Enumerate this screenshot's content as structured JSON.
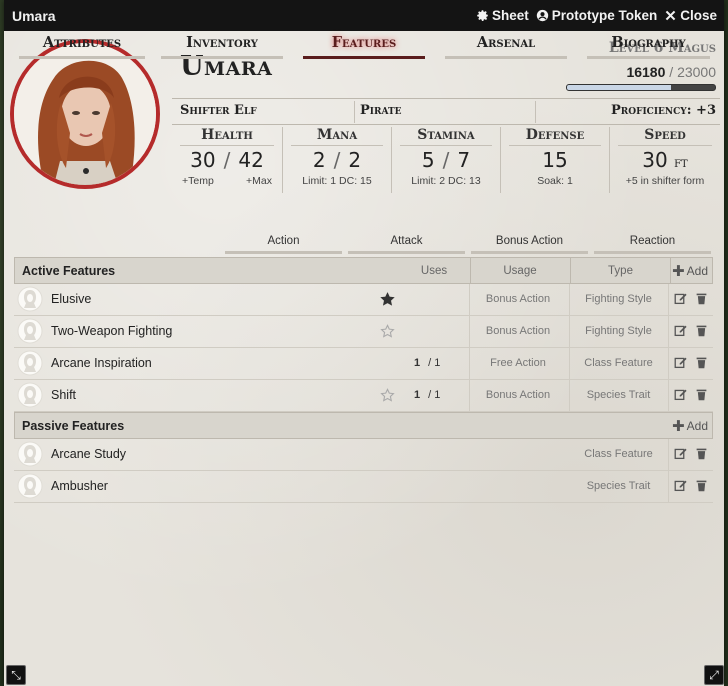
{
  "window": {
    "title": "Umara",
    "buttons": {
      "sheet": "Sheet",
      "prototype_token": "Prototype Token",
      "close": "Close"
    }
  },
  "header": {
    "name": "Umara",
    "level_line": "Level 6 Magus",
    "xp_current": "16180",
    "xp_max": "23000",
    "xp_progress": 0.7035,
    "ancestry": "Shifter Elf",
    "background": "Pirate",
    "proficiency": "Proficiency: +3"
  },
  "stats": {
    "health": {
      "label": "Health",
      "current": "30",
      "max": "42",
      "temp_label": "+Temp",
      "max_label": "+Max"
    },
    "mana": {
      "label": "Mana",
      "current": "2",
      "max": "2",
      "note": "Limit: 1 DC: 15"
    },
    "stamina": {
      "label": "Stamina",
      "current": "5",
      "max": "7",
      "note": "Limit: 2 DC: 13"
    },
    "defense": {
      "label": "Defense",
      "value": "15",
      "note": "Soak: 1"
    },
    "speed": {
      "label": "Speed",
      "value": "30",
      "unit": "ft",
      "note": "+5 in shifter form"
    }
  },
  "tabs": [
    "Attributes",
    "Inventory",
    "Features",
    "Arsenal",
    "Biography"
  ],
  "subtabs": [
    "Action",
    "Attack",
    "Bonus Action",
    "Reaction"
  ],
  "active_features": {
    "title": "Active Features",
    "col_uses": "Uses",
    "col_usage": "Usage",
    "col_type": "Type",
    "add": "Add",
    "rows": [
      {
        "name": "Elusive",
        "favorite": true,
        "uses": "",
        "uses_max": "",
        "usage": "Bonus Action",
        "type": "Fighting Style"
      },
      {
        "name": "Two-Weapon Fighting",
        "favorite": false,
        "uses": "",
        "uses_max": "",
        "usage": "Bonus Action",
        "type": "Fighting Style"
      },
      {
        "name": "Arcane Inspiration",
        "favorite": null,
        "uses": "1",
        "uses_max": "/ 1",
        "usage": "Free Action",
        "type": "Class Feature"
      },
      {
        "name": "Shift",
        "favorite": false,
        "uses": "1",
        "uses_max": "/ 1",
        "usage": "Bonus Action",
        "type": "Species Trait"
      }
    ]
  },
  "passive_features": {
    "title": "Passive Features",
    "add": "Add",
    "rows": [
      {
        "name": "Arcane Study",
        "type": "Class Feature"
      },
      {
        "name": "Ambusher",
        "type": "Species Trait"
      }
    ]
  },
  "colors": {
    "accent": "#5a1d1d",
    "portrait_border": "#b52b2b",
    "titlebar": "#141414"
  }
}
